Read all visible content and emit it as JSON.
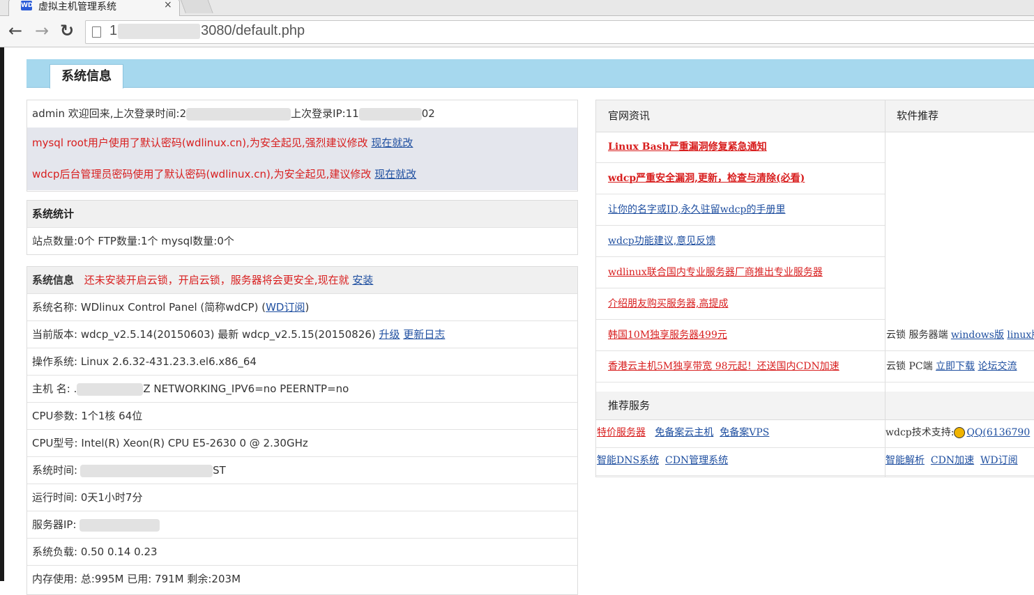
{
  "browser": {
    "tab_title": "虚拟主机管理系统",
    "tab_favicon": "WD",
    "tab_close": "×",
    "url_prefix": "1",
    "url_suffix": "3080/default.php"
  },
  "page": {
    "section_tab": "系统信息",
    "welcome": {
      "text": "admin 欢迎回来,上次登录时间:2",
      "ip_label": "上次登录IP:11",
      "ip_tail": "02"
    },
    "warnings": {
      "mysql_text": "mysql root用户使用了默认密码(wdlinux.cn),为安全起见,强烈建议修改",
      "mysql_link": "现在就改",
      "wdcp_text": "wdcp后台管理员密码使用了默认密码(wdlinux.cn),为安全起见,建议修改",
      "wdcp_link": "现在就改"
    },
    "stats": {
      "header": "系统统计",
      "line": "站点数量:0个   FTP数量:1个   mysql数量:0个"
    },
    "sysinfo": {
      "header": "系统信息",
      "cloudlock_note": "还未安装开启云锁，开启云锁，服务器将会更安全,现在就",
      "install_link": "安装",
      "name_label": "系统名称: WDlinux Control Panel (简称wdCP) (",
      "name_link": "WD订阅",
      "name_close": ")",
      "version_text": "当前版本: wdcp_v2.5.14(20150603) 最新 wdcp_v2.5.15(20150826)",
      "upgrade_link": "升级",
      "changelog_link": "更新日志",
      "os": "操作系统: Linux 2.6.32-431.23.3.el6.x86_64",
      "hostname_label": "主机 名: .",
      "hostname_tail": "Z NETWORKING_IPV6=no PEERNTP=no",
      "cpu_params": "CPU参数: 1个1核 64位",
      "cpu_model": "CPU型号:  Intel(R) Xeon(R) CPU E5-2630 0 @ 2.30GHz",
      "time_label": "系统时间:",
      "time_tail": "ST",
      "uptime": "运行时间: 0天1小时7分",
      "ip_label": "服务器IP:",
      "load": "系统负载: 0.50   0.14   0.23",
      "memory": "内存使用: 总:995M   已用: 791M   剩余:203M"
    },
    "right": {
      "news_header": "官网资讯",
      "software_header": "软件推荐",
      "news": [
        "Linux Bash严重漏洞修复紧急通知",
        "wdcp严重安全漏洞,更新，检查与清除(必看)",
        "让你的名字或ID,永久驻留wdcp的手册里",
        "wdcp功能建议,意见反馈",
        "wdlinux联合国内专业服务器厂商推出专业服务器",
        "介绍朋友购买服务器,高提成",
        "韩国10M独享服务器499元",
        "香港云主机5M独享带宽 98元起！还送国内CDN加速"
      ],
      "software": {
        "row1_label": "云锁 服务器端",
        "row1_link1": "windows版",
        "row1_link2": "linux版",
        "row2_label": "云锁 PC端",
        "row2_link1": "立即下载",
        "row2_link2": "论坛交流"
      },
      "services_header": "推荐服务",
      "services_row1": [
        "特价服务器",
        "免备案云主机",
        "免备案VPS"
      ],
      "services_row2": [
        "智能DNS系统",
        "CDN管理系统"
      ],
      "support_label": "wdcp技术支持:",
      "support_link": "QQ(6136790",
      "right_row2": [
        "智能解析",
        "CDN加速",
        "WD订阅"
      ]
    }
  }
}
